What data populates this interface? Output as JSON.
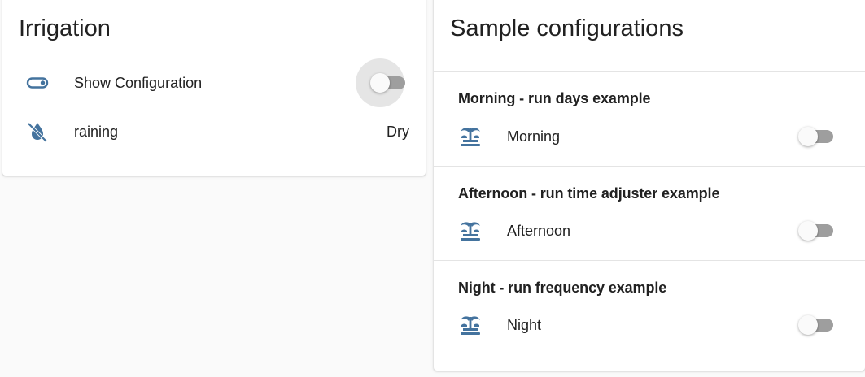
{
  "colors": {
    "icon": "#44739e",
    "card": "#ffffff",
    "page": "#fafafa",
    "switch_track_off": "#9e9e9e"
  },
  "irrigation": {
    "title": "Irrigation",
    "rows": [
      {
        "icon": "toggle-switch-outline-icon",
        "label": "Show Configuration",
        "state": "off"
      },
      {
        "icon": "water-off-icon",
        "label": "raining",
        "state": "Dry"
      }
    ]
  },
  "samples": {
    "title": "Sample configurations",
    "sections": [
      {
        "heading": "Morning - run days example",
        "icon": "fountain-icon",
        "label": "Morning",
        "state": "off"
      },
      {
        "heading": "Afternoon - run time adjuster example",
        "icon": "fountain-icon",
        "label": "Afternoon",
        "state": "off"
      },
      {
        "heading": "Night - run frequency example",
        "icon": "fountain-icon",
        "label": "Night",
        "state": "off"
      }
    ]
  }
}
